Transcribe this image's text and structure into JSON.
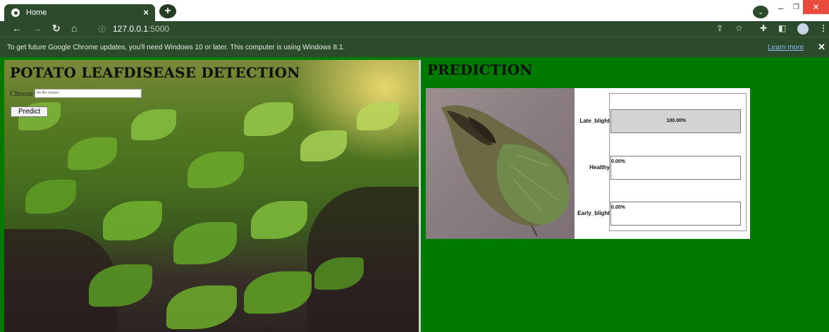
{
  "browser": {
    "tab_title": "Home",
    "url_host": "127.0.0.1",
    "url_port": ":5000",
    "infobar_message": "To get future Google Chrome updates, you'll need Windows 10 or later. This computer is using Windows 8.1.",
    "infobar_link": "Learn more"
  },
  "left_panel": {
    "title": "POTATO LEAFDISEASE DETECTION",
    "choose_label": "Choose",
    "file_placeholder": "No file chosen",
    "predict_label": "Predict"
  },
  "right_panel": {
    "title": "PREDICTION"
  },
  "chart_data": {
    "type": "bar",
    "orientation": "horizontal",
    "categories": [
      "Late_blight",
      "Healthy",
      "Early_blight"
    ],
    "values": [
      100.0,
      0.0,
      0.0
    ],
    "value_labels": [
      "100.00%",
      "0.00%",
      "0.00%"
    ],
    "xlim": [
      0,
      100
    ]
  },
  "colors": {
    "page_background": "#007a00",
    "browser_frame": "#2c4a2c",
    "bar_fill": "#d3d3d3"
  }
}
